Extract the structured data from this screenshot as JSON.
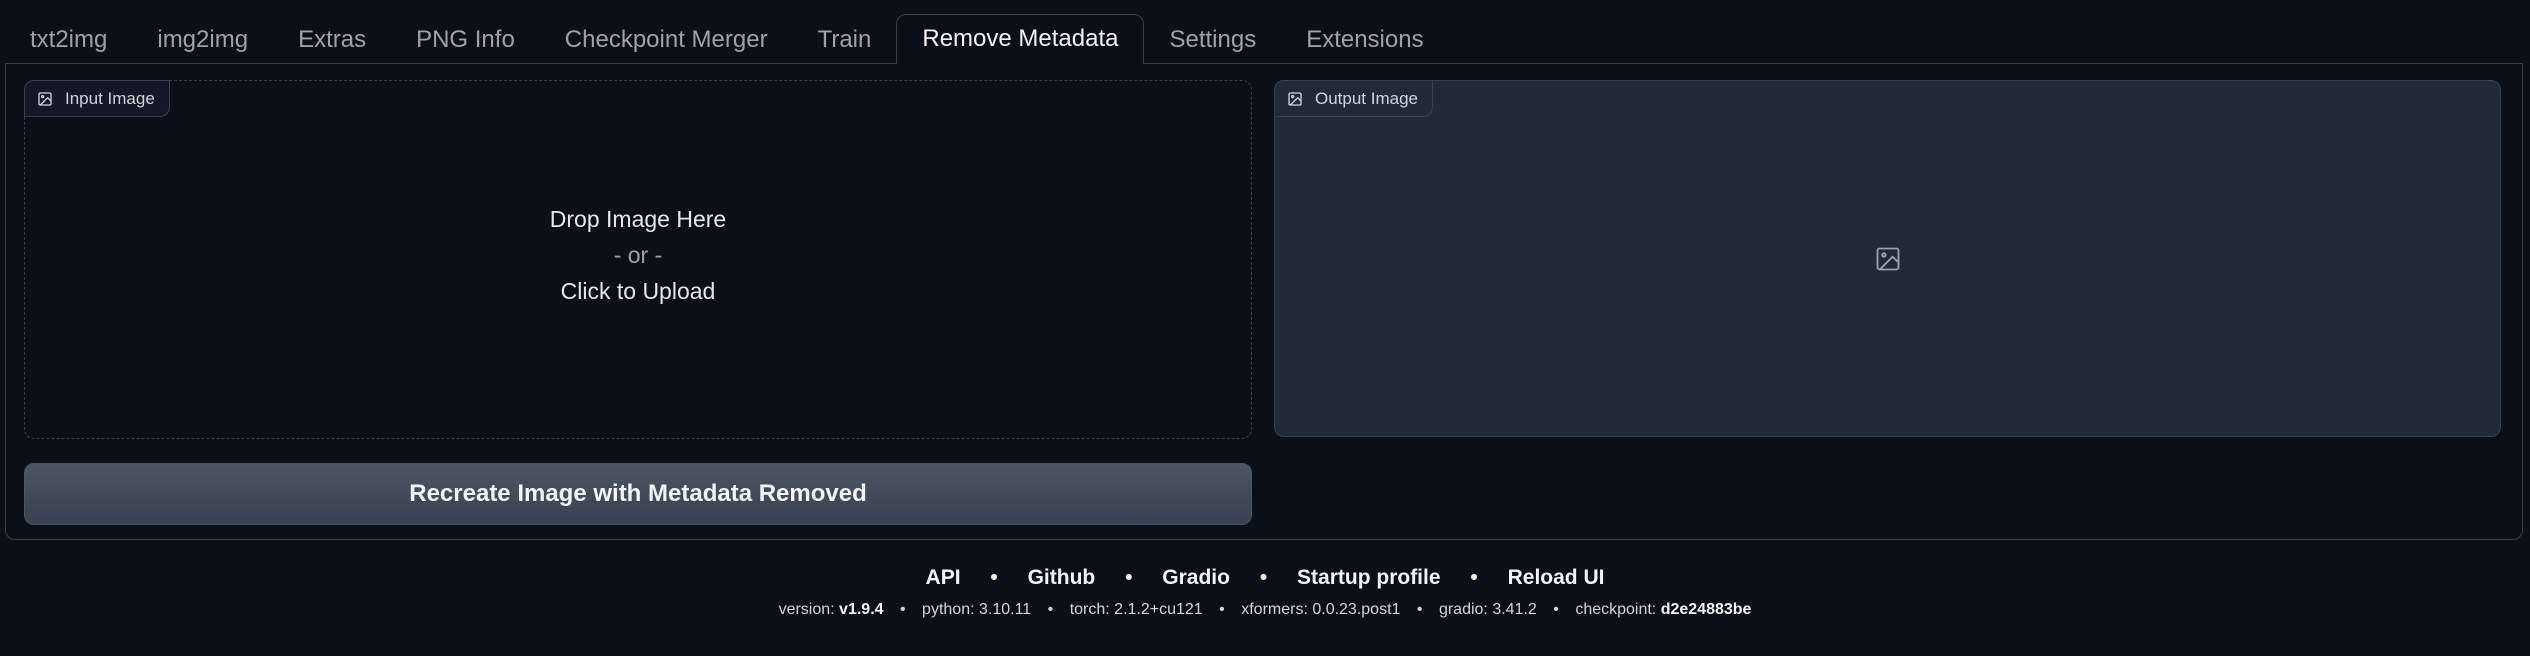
{
  "tabs": [
    {
      "label": "txt2img",
      "selected": false
    },
    {
      "label": "img2img",
      "selected": false
    },
    {
      "label": "Extras",
      "selected": false
    },
    {
      "label": "PNG Info",
      "selected": false
    },
    {
      "label": "Checkpoint Merger",
      "selected": false
    },
    {
      "label": "Train",
      "selected": false
    },
    {
      "label": "Remove Metadata",
      "selected": true
    },
    {
      "label": "Settings",
      "selected": false
    },
    {
      "label": "Extensions",
      "selected": false
    }
  ],
  "input_image": {
    "label": "Input Image",
    "icon": "image-icon",
    "drop_text": "Drop Image Here",
    "or_text": "- or -",
    "upload_text": "Click to Upload"
  },
  "output_image": {
    "label": "Output Image",
    "icon": "image-icon",
    "placeholder_icon": "image-placeholder-icon"
  },
  "action_button": {
    "label": "Recreate Image with Metadata Removed"
  },
  "footer": {
    "links": [
      "API",
      "Github",
      "Gradio",
      "Startup profile",
      "Reload UI"
    ],
    "separator": "•",
    "versions": [
      {
        "key": "version:",
        "value": "v1.9.4",
        "bold": true
      },
      {
        "key": "python:",
        "value": "3.10.11",
        "bold": false
      },
      {
        "key": "torch:",
        "value": "2.1.2+cu121",
        "bold": false
      },
      {
        "key": "xformers:",
        "value": "0.0.23.post1",
        "bold": false
      },
      {
        "key": "gradio:",
        "value": "3.41.2",
        "bold": false
      },
      {
        "key": "checkpoint:",
        "value": "d2e24883be",
        "bold": true
      }
    ]
  },
  "colors": {
    "background": "#0b0f19",
    "border": "#374151",
    "output_fill": "#1f2937",
    "button_fill": "#4b5563"
  }
}
